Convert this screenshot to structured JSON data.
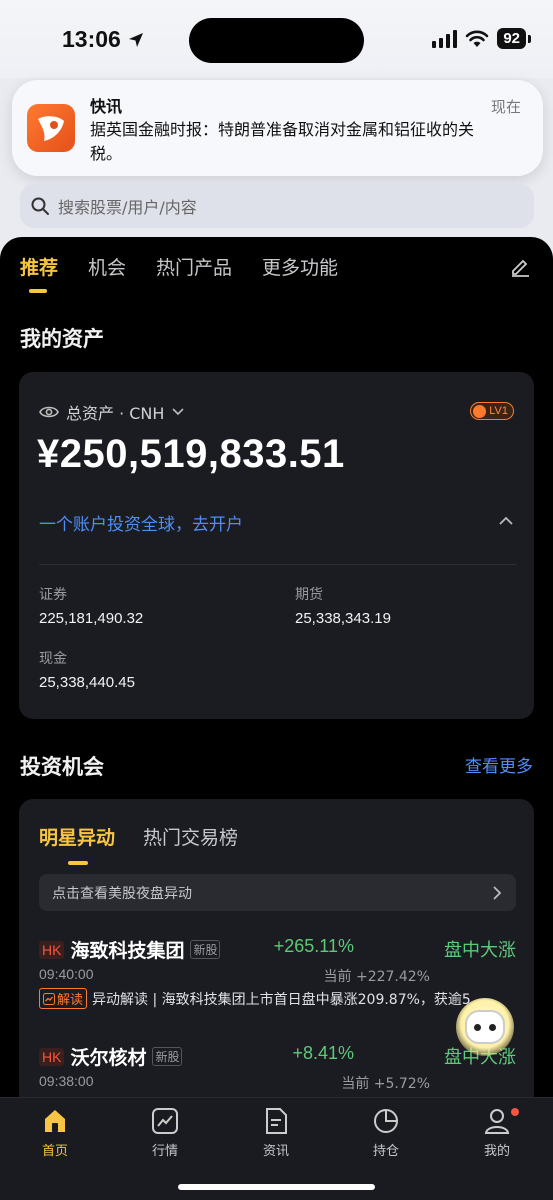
{
  "status_bar": {
    "time": "13:06",
    "battery": "92"
  },
  "notification": {
    "title": "快讯",
    "body": "据英国金融时报：特朗普准备取消对金属和铝征收的关税。",
    "time": "现在"
  },
  "search": {
    "placeholder": "搜索股票/用户/内容"
  },
  "tabs": [
    "推荐",
    "机会",
    "热门产品",
    "更多功能"
  ],
  "assets": {
    "section_title": "我的资产",
    "label": "总资产 · CNH",
    "level": "LV1",
    "total": "¥250,519,833.51",
    "promo": "一个账户投资全球，去开户",
    "stats": [
      {
        "label": "证券",
        "value": "225,181,490.32"
      },
      {
        "label": "期货",
        "value": "25,338,343.19"
      },
      {
        "label": "现金",
        "value": "25,338,440.45"
      }
    ]
  },
  "opportunities": {
    "section_title": "投资机会",
    "see_more": "查看更多",
    "tabs": [
      "明星异动",
      "热门交易榜"
    ],
    "notice": "点击查看美股夜盘异动",
    "stocks": [
      {
        "market": "HK",
        "name": "海致科技集团",
        "tag": "新股",
        "change": "+265.11%",
        "status": "盘中大涨",
        "time": "09:40:00",
        "pre": "当前 +227.42%",
        "interp_label": "解读",
        "interp_text": "异动解读 | 海致科技集团上市首日盘中暴涨209.87%，获逾5"
      },
      {
        "market": "HK",
        "name": "沃尔核材",
        "tag": "新股",
        "change": "+8.41%",
        "status": "盘中大涨",
        "time": "09:38:00",
        "pre": "当前 +5.72%"
      }
    ]
  },
  "tab_bar": [
    {
      "label": "首页",
      "icon": "home-icon",
      "active": true
    },
    {
      "label": "行情",
      "icon": "chart-icon"
    },
    {
      "label": "资讯",
      "icon": "news-icon"
    },
    {
      "label": "持仓",
      "icon": "pie-icon"
    },
    {
      "label": "我的",
      "icon": "user-icon"
    }
  ],
  "colors": {
    "accent": "#f6c543",
    "link": "#4f8ef7",
    "up": "#5ec97a",
    "tag_red": "#f5553f",
    "orange": "#ff7a2f"
  }
}
